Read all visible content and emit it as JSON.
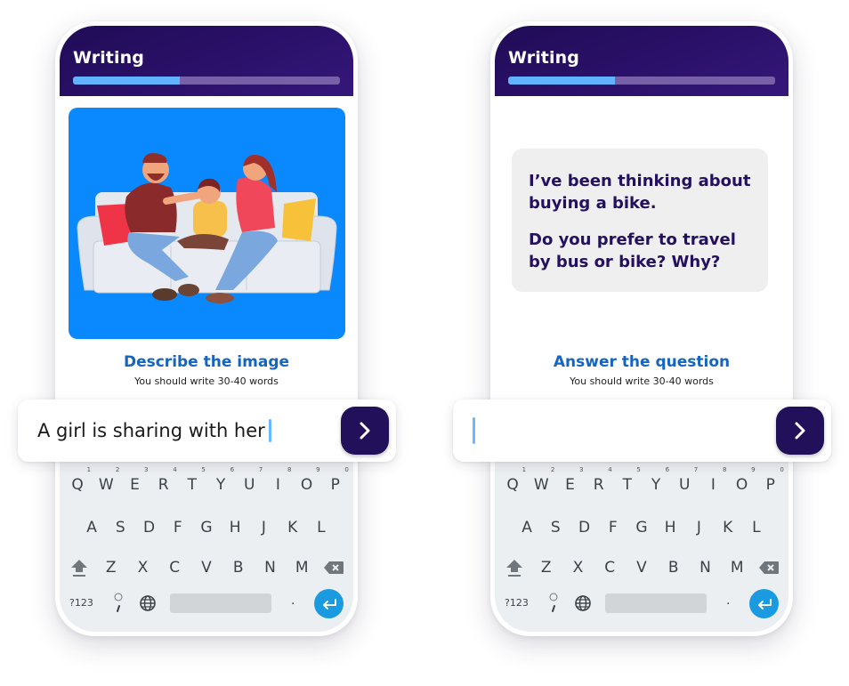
{
  "colors": {
    "header_bg": "#22105a",
    "progress_fill": "#62b3ff",
    "progress_track": "#7760a8",
    "task_title": "#1565c0",
    "prompt_text": "#24105e",
    "send_button": "#22105a",
    "enter_key": "#1a9be1",
    "image_bg": "#0a88fd"
  },
  "screens": [
    {
      "header": {
        "title": "Writing",
        "progress_percent": 40
      },
      "content": {
        "type": "image",
        "image_alt": "Illustration of a family sitting on a sofa: a father and mother comforting a crying girl"
      },
      "task": {
        "title": "Describe the image",
        "subtitle": "You should write 30-40 words"
      },
      "input": {
        "value": "A girl is sharing with her",
        "placeholder": ""
      },
      "send_icon": "chevron-right-icon"
    },
    {
      "header": {
        "title": "Writing",
        "progress_percent": 40
      },
      "content": {
        "type": "prompt",
        "paragraphs": [
          "I’ve been thinking about buying a bike.",
          "Do you prefer to travel by bus or bike? Why?"
        ]
      },
      "task": {
        "title": "Answer the question",
        "subtitle": "You should write 30-40 words"
      },
      "input": {
        "value": "",
        "placeholder": ""
      },
      "send_icon": "chevron-right-icon"
    }
  ],
  "keyboard": {
    "row1": [
      {
        "key": "Q",
        "hint": "1"
      },
      {
        "key": "W",
        "hint": "2"
      },
      {
        "key": "E",
        "hint": "3"
      },
      {
        "key": "R",
        "hint": "4"
      },
      {
        "key": "T",
        "hint": "5"
      },
      {
        "key": "Y",
        "hint": "6"
      },
      {
        "key": "U",
        "hint": "7"
      },
      {
        "key": "I",
        "hint": "8"
      },
      {
        "key": "O",
        "hint": "9"
      },
      {
        "key": "P",
        "hint": "0"
      }
    ],
    "row2": [
      "A",
      "S",
      "D",
      "F",
      "G",
      "H",
      "J",
      "K",
      "L"
    ],
    "row3": [
      "Z",
      "X",
      "C",
      "V",
      "B",
      "N",
      "M"
    ],
    "symbols_label": "?123",
    "period_label": ".",
    "icons": {
      "shift": "shift-icon",
      "backspace": "backspace-icon",
      "comma": "comma-key-icon",
      "globe": "globe-icon",
      "enter": "enter-icon"
    }
  }
}
